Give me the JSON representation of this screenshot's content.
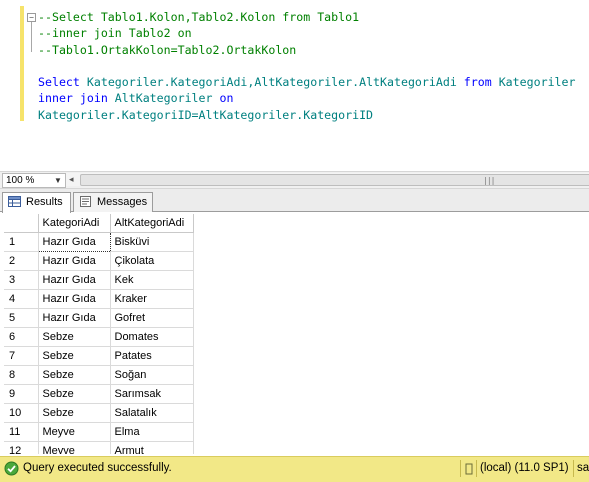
{
  "editor": {
    "lines": [
      {
        "segments": [
          {
            "t": "--Select Tablo1.Kolon,Tablo2.Kolon from Tablo1",
            "c": "cm"
          }
        ]
      },
      {
        "segments": [
          {
            "t": "--inner join Tablo2 on",
            "c": "cm"
          }
        ]
      },
      {
        "segments": [
          {
            "t": "--Tablo1.OrtakKolon=Tablo2.OrtakKolon",
            "c": "cm"
          }
        ]
      },
      {
        "segments": []
      },
      {
        "segments": [
          {
            "t": "Select ",
            "c": "kw"
          },
          {
            "t": "Kategoriler.KategoriAdi,AltKategoriler.AltKategoriAdi ",
            "c": "tx"
          },
          {
            "t": "from ",
            "c": "kw"
          },
          {
            "t": "Kategoriler",
            "c": "tx"
          }
        ]
      },
      {
        "segments": [
          {
            "t": "inner join ",
            "c": "kw"
          },
          {
            "t": "AltKategoriler ",
            "c": "tx"
          },
          {
            "t": "on",
            "c": "kw"
          }
        ]
      },
      {
        "segments": [
          {
            "t": "Kategoriler.KategoriID=AltKategoriler.KategoriID",
            "c": "tx"
          }
        ]
      }
    ],
    "collapse_glyph": "−"
  },
  "zoom": {
    "value": "100 %",
    "arrow": "▼"
  },
  "tabs": [
    {
      "label": "Results",
      "icon": "results-grid-icon"
    },
    {
      "label": "Messages",
      "icon": "messages-icon"
    }
  ],
  "grid": {
    "columns": [
      "KategoriAdi",
      "AltKategoriAdi"
    ],
    "rows": [
      {
        "n": "1",
        "cat": "Hazır Gıda",
        "sub": "Bisküvi"
      },
      {
        "n": "2",
        "cat": "Hazır Gıda",
        "sub": "Çikolata"
      },
      {
        "n": "3",
        "cat": "Hazır Gıda",
        "sub": "Kek"
      },
      {
        "n": "4",
        "cat": "Hazır Gıda",
        "sub": "Kraker"
      },
      {
        "n": "5",
        "cat": "Hazır Gıda",
        "sub": "Gofret"
      },
      {
        "n": "6",
        "cat": "Sebze",
        "sub": "Domates"
      },
      {
        "n": "7",
        "cat": "Sebze",
        "sub": "Patates"
      },
      {
        "n": "8",
        "cat": "Sebze",
        "sub": "Soğan"
      },
      {
        "n": "9",
        "cat": "Sebze",
        "sub": "Sarımsak"
      },
      {
        "n": "10",
        "cat": "Sebze",
        "sub": "Salatalık"
      },
      {
        "n": "11",
        "cat": "Meyve",
        "sub": "Elma"
      },
      {
        "n": "12",
        "cat": "Meyve",
        "sub": "Armut"
      }
    ]
  },
  "status": {
    "message": "Query executed successfully.",
    "server": "(local) (11.0 SP1)",
    "tail": "sa"
  },
  "colors": {
    "keyword": "#0000ff",
    "comment": "#008000",
    "identifier": "#008080",
    "status_bg": "#f2e887"
  }
}
